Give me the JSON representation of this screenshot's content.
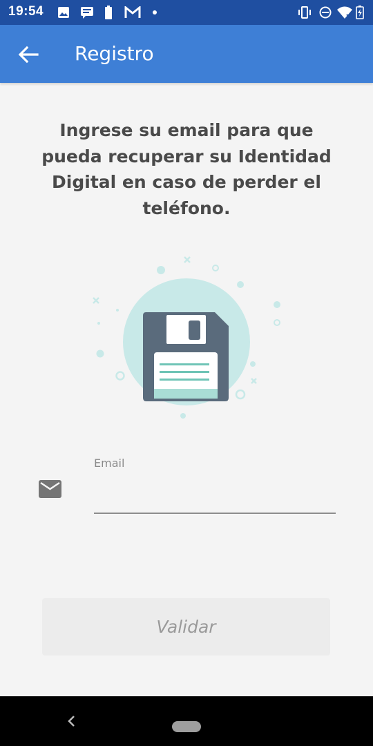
{
  "status_bar": {
    "time": "19:54",
    "left_icons": [
      "image-icon",
      "message-icon",
      "battery-small-icon",
      "gmail-icon",
      "dot-icon"
    ],
    "right_icons": [
      "vibrate-icon",
      "do-not-disturb-icon",
      "wifi-icon",
      "battery-icon"
    ]
  },
  "app_bar": {
    "title": "Registro",
    "back_icon": "arrow-left-icon",
    "color": "#3e7fd6"
  },
  "main": {
    "instruction": "Ingrese su email para que pueda recuperar su Identidad Digital en caso de perder el teléfono.",
    "illustration": "floppy-disk-icon",
    "email": {
      "label": "Email",
      "value": "",
      "icon": "mail-icon"
    },
    "validate_button": "Validar"
  },
  "colors": {
    "status_bar": "#1f4fa1",
    "primary": "#3e7fd6",
    "illustration_circle": "#c8e9e8",
    "floppy_body": "#5a6b7c",
    "floppy_label_stripe": "#6fc4b6"
  }
}
